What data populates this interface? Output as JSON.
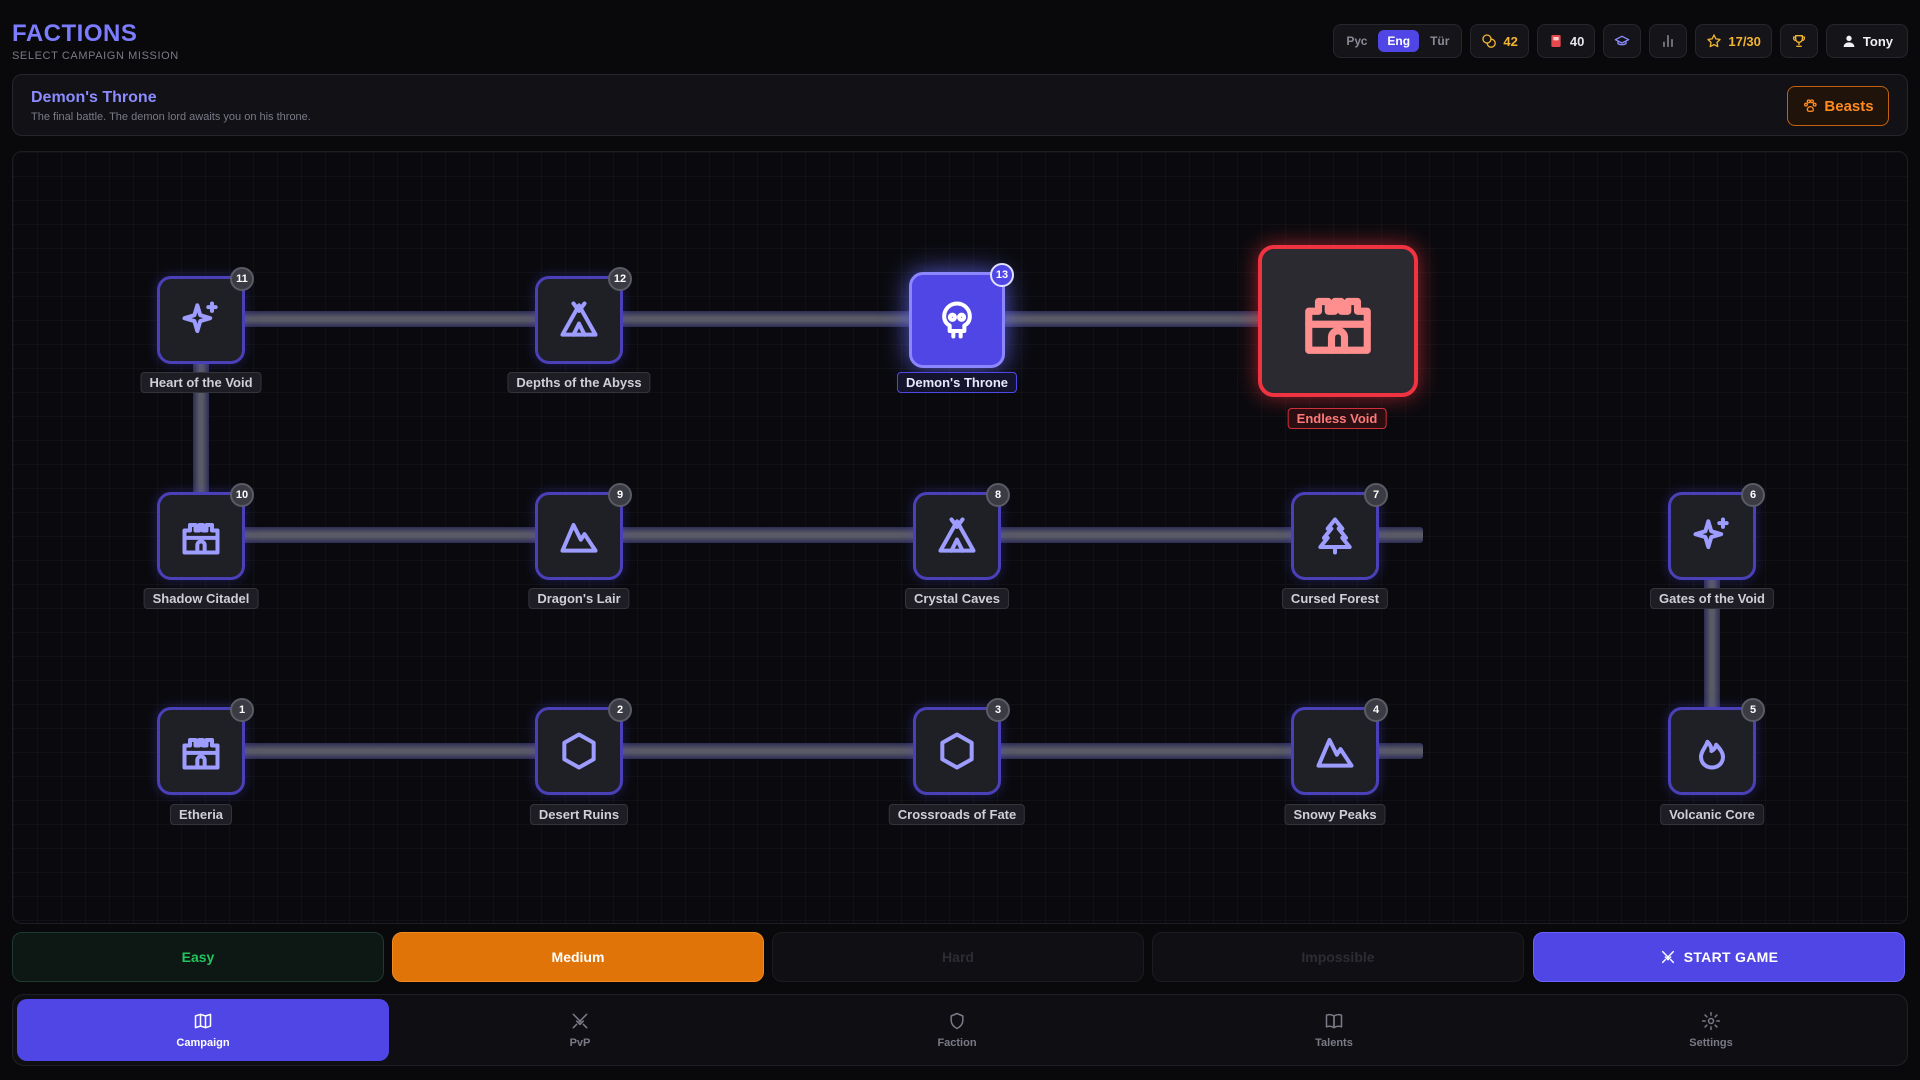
{
  "app": {
    "title": "FACTIONS",
    "subtitle": "SELECT CAMPAIGN MISSION"
  },
  "topbar": {
    "languages": [
      "Рус",
      "Eng",
      "Tür"
    ],
    "active_language": "Eng",
    "gold": "42",
    "tickets": "40",
    "stars": "17/30",
    "user": "Tony"
  },
  "mission": {
    "title": "Demon's Throne",
    "description": "The final battle. The demon lord awaits you on his throne.",
    "faction_button": "Beasts"
  },
  "map": {
    "nodes": [
      {
        "id": "1",
        "name": "Etheria",
        "icon": "castle-icon"
      },
      {
        "id": "2",
        "name": "Desert Ruins",
        "icon": "hexagon-icon"
      },
      {
        "id": "3",
        "name": "Crossroads of Fate",
        "icon": "hexagon-icon"
      },
      {
        "id": "4",
        "name": "Snowy Peaks",
        "icon": "mountain-icon"
      },
      {
        "id": "5",
        "name": "Volcanic Core",
        "icon": "flame-icon"
      },
      {
        "id": "6",
        "name": "Gates of the Void",
        "icon": "sparkles-icon"
      },
      {
        "id": "7",
        "name": "Cursed Forest",
        "icon": "tree-icon"
      },
      {
        "id": "8",
        "name": "Crystal Caves",
        "icon": "tent-icon"
      },
      {
        "id": "9",
        "name": "Dragon's Lair",
        "icon": "mountain-icon"
      },
      {
        "id": "10",
        "name": "Shadow Citadel",
        "icon": "castle-icon"
      },
      {
        "id": "11",
        "name": "Heart of the Void",
        "icon": "sparkles-icon"
      },
      {
        "id": "12",
        "name": "Depths of the Abyss",
        "icon": "tent-icon"
      },
      {
        "id": "13",
        "name": "Demon's Throne",
        "icon": "skull-icon"
      }
    ],
    "boss": {
      "name": "Endless Void",
      "icon": "castle-icon"
    },
    "current_node": "13"
  },
  "difficulty": {
    "options": [
      "Easy",
      "Medium",
      "Hard",
      "Impossible"
    ],
    "selected": "Medium"
  },
  "start_button": "START GAME",
  "nav": {
    "tabs": [
      "Campaign",
      "PvP",
      "Faction",
      "Talents",
      "Settings"
    ],
    "active": "Campaign"
  },
  "colors": {
    "accent": "#4f46e5",
    "medium": "#e07408",
    "easy": "#22c55e",
    "boss": "#ef3340",
    "gold": "#f2b532",
    "faction": "#ff8a1f"
  }
}
